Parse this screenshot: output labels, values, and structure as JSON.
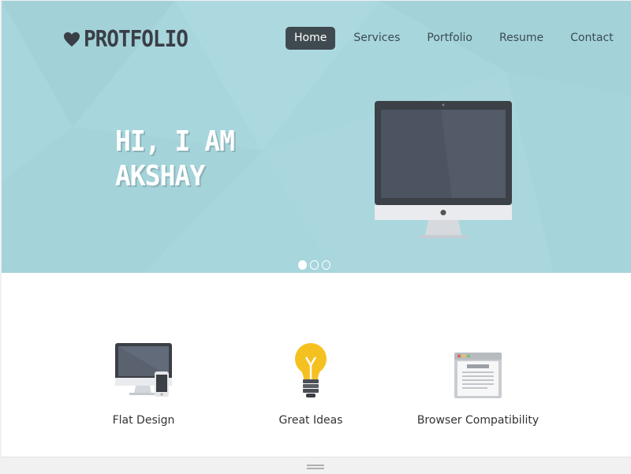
{
  "brand": {
    "name": "PROTFOLIO",
    "icon": "heart-icon"
  },
  "nav": [
    {
      "label": "Home",
      "active": true
    },
    {
      "label": "Services",
      "active": false
    },
    {
      "label": "Portfolio",
      "active": false
    },
    {
      "label": "Resume",
      "active": false
    },
    {
      "label": "Contact",
      "active": false
    }
  ],
  "hero": {
    "line1": "HI, I AM",
    "line2": "AKSHAY",
    "image": "imac-icon",
    "slider": {
      "count": 3,
      "active_index": 0
    }
  },
  "features": [
    {
      "label": "Flat Design",
      "icon": "devices-icon"
    },
    {
      "label": "Great Ideas",
      "icon": "lightbulb-icon"
    },
    {
      "label": "Browser Compatibility",
      "icon": "browser-window-icon"
    }
  ],
  "colors": {
    "hero_background": "#a7d6dc",
    "nav_active": "#3f4a50",
    "text_dark": "#3a3f47"
  }
}
